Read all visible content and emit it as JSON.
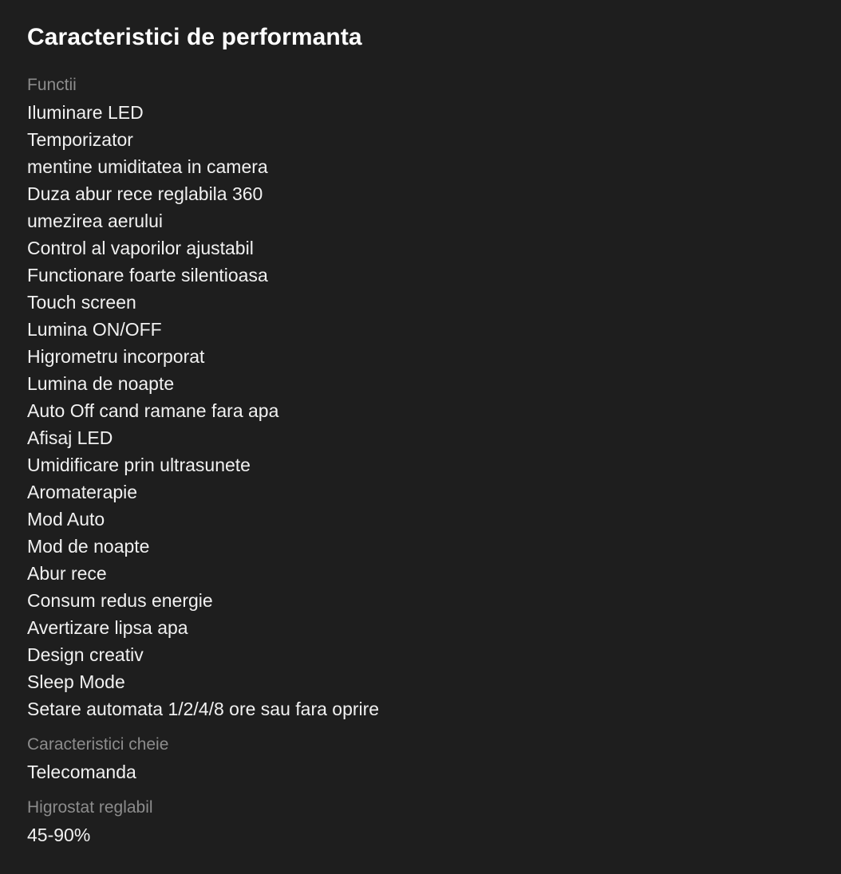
{
  "page": {
    "title": "Caracteristici de performanta",
    "background_color": "#1e1e1e",
    "label_color": "#8c8c8c",
    "value_color": "#f1f1f1"
  },
  "sections": [
    {
      "label": "Functii",
      "values": [
        "Iluminare LED",
        "Temporizator",
        "mentine umiditatea in camera",
        "Duza abur rece reglabila 360",
        "umezirea aerului",
        "Control al vaporilor ajustabil",
        "Functionare foarte silentioasa",
        "Touch screen",
        "Lumina ON/OFF",
        "Higrometru incorporat",
        "Lumina de noapte",
        "Auto Off cand ramane fara apa",
        "Afisaj LED",
        "Umidificare prin ultrasunete",
        "Aromaterapie",
        "Mod Auto",
        "Mod de noapte",
        "Abur rece",
        "Consum redus energie",
        "Avertizare lipsa apa",
        "Design creativ",
        "Sleep Mode",
        "Setare automata 1/2/4/8 ore sau fara oprire"
      ]
    },
    {
      "label": "Caracteristici cheie",
      "values": [
        "Telecomanda"
      ]
    },
    {
      "label": "Higrostat reglabil",
      "values": [
        "45-90%"
      ]
    }
  ]
}
